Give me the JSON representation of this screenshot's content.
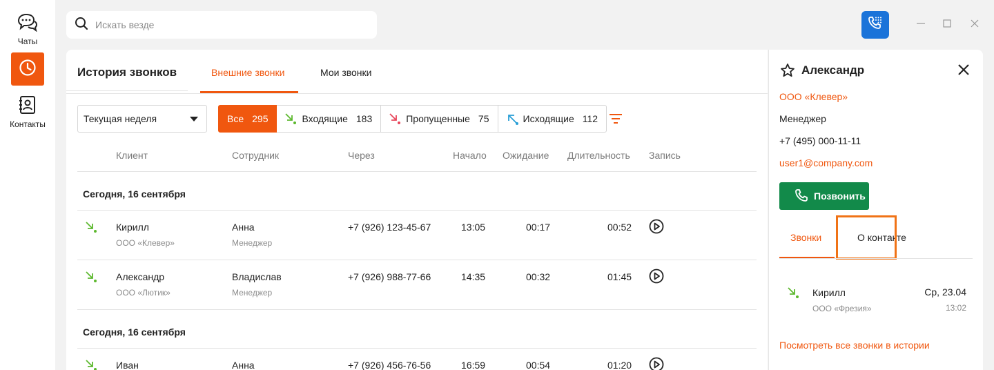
{
  "sidebar": {
    "chats_label": "Чаты",
    "contacts_label": "Контакты"
  },
  "search": {
    "placeholder": "Искать везде"
  },
  "main": {
    "title": "История звонков",
    "tabs": [
      "Внешние звонки",
      "Мои звонки"
    ],
    "period": "Текущая неделя",
    "filters": [
      {
        "label": "Все",
        "count": "295"
      },
      {
        "label": "Входящие",
        "count": "183"
      },
      {
        "label": "Пропущенные",
        "count": "75"
      },
      {
        "label": "Исходящие",
        "count": "112"
      }
    ],
    "columns": [
      "Клиент",
      "Сотрудник",
      "Через",
      "Начало",
      "Ожидание",
      "Длительность",
      "Запись"
    ],
    "groups": [
      {
        "title": "Сегодня, 16 сентября",
        "rows": [
          {
            "client": "Кирилл",
            "company": "ООО «Клевер»",
            "employee": "Анна",
            "role": "Менеджер",
            "via": "+7 (926) 123-45-67",
            "start": "13:05",
            "wait": "00:17",
            "duration": "00:52"
          },
          {
            "client": "Александр",
            "company": "ООО «Лютик»",
            "employee": "Владислав",
            "role": "Менеджер",
            "via": "+7 (926) 988-77-66",
            "start": "14:35",
            "wait": "00:32",
            "duration": "01:45"
          }
        ]
      },
      {
        "title": "Сегодня, 16 сентября",
        "rows": [
          {
            "client": "Иван",
            "employee": "Анна",
            "via": "+7 (926) 456-76-56",
            "start": "16:59",
            "wait": "00:54",
            "duration": "01:20"
          }
        ]
      }
    ]
  },
  "detail": {
    "name": "Александр",
    "company": "ООО «Клевер»",
    "position": "Менеджер",
    "phone": "+7 (495) 000-11-11",
    "email": "user1@company.com",
    "call_label": "Позвонить",
    "tabs": [
      "Звонки",
      "О контакте"
    ],
    "recent_call": {
      "name": "Кирилл",
      "company": "ООО «Фрезия»",
      "date": "Ср, 23.04",
      "time": "13:02"
    },
    "view_all": "Посмотреть все звонки в истории"
  },
  "colors": {
    "accent": "#f0570f",
    "call_button": "#128a4a",
    "top_call": "#1a73d9",
    "incoming": "#5cb82e",
    "missed": "#e8455a",
    "outgoing": "#2a9fd6"
  }
}
